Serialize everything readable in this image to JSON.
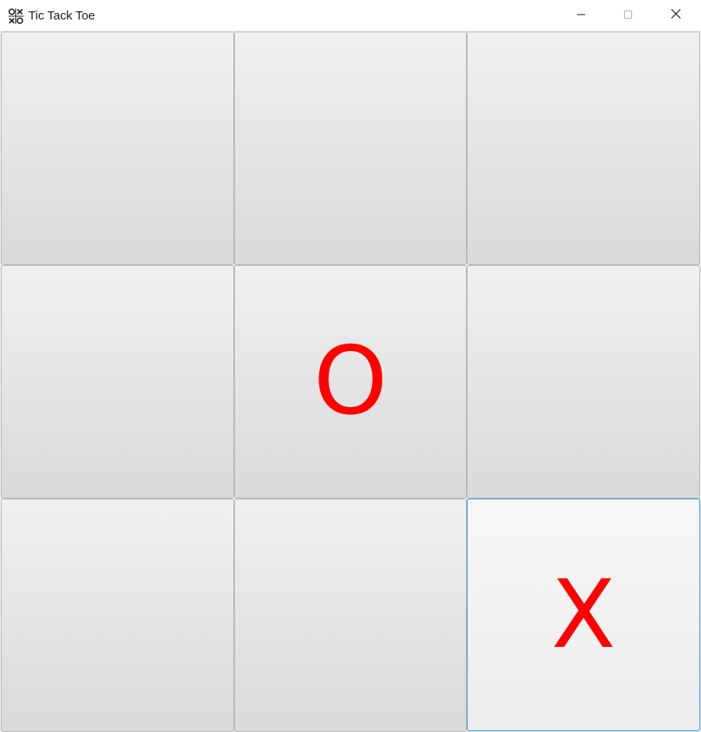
{
  "window": {
    "title": "Tic Tack Toe",
    "app_icon": "tic-tac-toe-icon",
    "controls": [
      "minimize-icon",
      "maximize-icon",
      "close-icon"
    ]
  },
  "board": {
    "mark_color": "#ff0000",
    "focus_color": "#27a0d6",
    "cells": [
      {
        "mark": ""
      },
      {
        "mark": ""
      },
      {
        "mark": ""
      },
      {
        "mark": ""
      },
      {
        "mark": "O"
      },
      {
        "mark": ""
      },
      {
        "mark": ""
      },
      {
        "mark": ""
      },
      {
        "mark": "X",
        "focused": true
      }
    ]
  }
}
